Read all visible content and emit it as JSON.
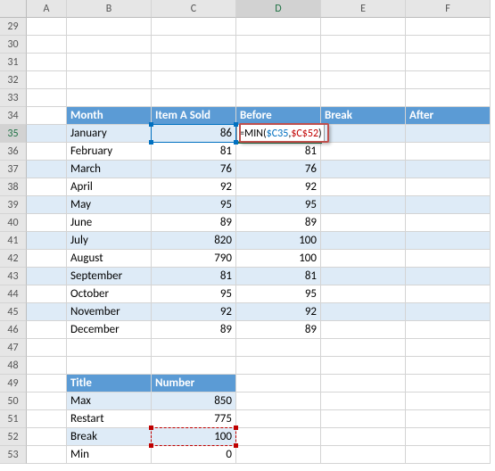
{
  "columns": [
    "A",
    "B",
    "C",
    "D",
    "E",
    "F"
  ],
  "rows": [
    29,
    30,
    31,
    32,
    33,
    34,
    35,
    36,
    37,
    38,
    39,
    40,
    41,
    42,
    43,
    44,
    45,
    46,
    47,
    48,
    49,
    50,
    51,
    52,
    53
  ],
  "active_cell": "D35",
  "formula": {
    "text": "=MIN($C35,$C$52)",
    "parts": [
      {
        "t": "=MIN(",
        "c": "fn-black"
      },
      {
        "t": "$C35",
        "c": "fn-blue"
      },
      {
        "t": ",",
        "c": "fn-black"
      },
      {
        "t": "$C$52",
        "c": "fn-red"
      },
      {
        "t": ")",
        "c": "fn-black"
      }
    ]
  },
  "table1": {
    "headers": [
      "Month",
      "Item A Sold",
      "Before",
      "Break",
      "After"
    ],
    "rows": [
      {
        "r": 35,
        "month": "January",
        "sold": 86,
        "before": "",
        "band": true
      },
      {
        "r": 36,
        "month": "February",
        "sold": 81,
        "before": 81,
        "band": false
      },
      {
        "r": 37,
        "month": "March",
        "sold": 76,
        "before": 76,
        "band": true
      },
      {
        "r": 38,
        "month": "April",
        "sold": 92,
        "before": 92,
        "band": false
      },
      {
        "r": 39,
        "month": "May",
        "sold": 95,
        "before": 95,
        "band": true
      },
      {
        "r": 40,
        "month": "June",
        "sold": 89,
        "before": 89,
        "band": false
      },
      {
        "r": 41,
        "month": "July",
        "sold": 820,
        "before": 100,
        "band": true
      },
      {
        "r": 42,
        "month": "August",
        "sold": 790,
        "before": 100,
        "band": false
      },
      {
        "r": 43,
        "month": "September",
        "sold": 81,
        "before": 81,
        "band": true
      },
      {
        "r": 44,
        "month": "October",
        "sold": 95,
        "before": 95,
        "band": false
      },
      {
        "r": 45,
        "month": "November",
        "sold": 92,
        "before": 92,
        "band": true
      },
      {
        "r": 46,
        "month": "December",
        "sold": 89,
        "before": 89,
        "band": false
      }
    ]
  },
  "table2": {
    "headers": [
      "Title",
      "Number"
    ],
    "rows": [
      {
        "r": 50,
        "title": "Max",
        "number": 850,
        "band": true
      },
      {
        "r": 51,
        "title": "Restart",
        "number": 775,
        "band": false
      },
      {
        "r": 52,
        "title": "Break",
        "number": 100,
        "band": true
      },
      {
        "r": 53,
        "title": "Min",
        "number": 0,
        "band": false
      }
    ]
  },
  "chart_data": {
    "type": "table",
    "tables": [
      {
        "title": "Monthly Item A Sold",
        "columns": [
          "Month",
          "Item A Sold",
          "Before",
          "Break",
          "After"
        ],
        "rows": [
          [
            "January",
            86,
            null,
            null,
            null
          ],
          [
            "February",
            81,
            81,
            null,
            null
          ],
          [
            "March",
            76,
            76,
            null,
            null
          ],
          [
            "April",
            92,
            92,
            null,
            null
          ],
          [
            "May",
            95,
            95,
            null,
            null
          ],
          [
            "June",
            89,
            89,
            null,
            null
          ],
          [
            "July",
            820,
            100,
            null,
            null
          ],
          [
            "August",
            790,
            100,
            null,
            null
          ],
          [
            "September",
            81,
            81,
            null,
            null
          ],
          [
            "October",
            95,
            95,
            null,
            null
          ],
          [
            "November",
            92,
            92,
            null,
            null
          ],
          [
            "December",
            89,
            89,
            null,
            null
          ]
        ]
      },
      {
        "title": "Break Parameters",
        "columns": [
          "Title",
          "Number"
        ],
        "rows": [
          [
            "Max",
            850
          ],
          [
            "Restart",
            775
          ],
          [
            "Break",
            100
          ],
          [
            "Min",
            0
          ]
        ]
      }
    ]
  }
}
